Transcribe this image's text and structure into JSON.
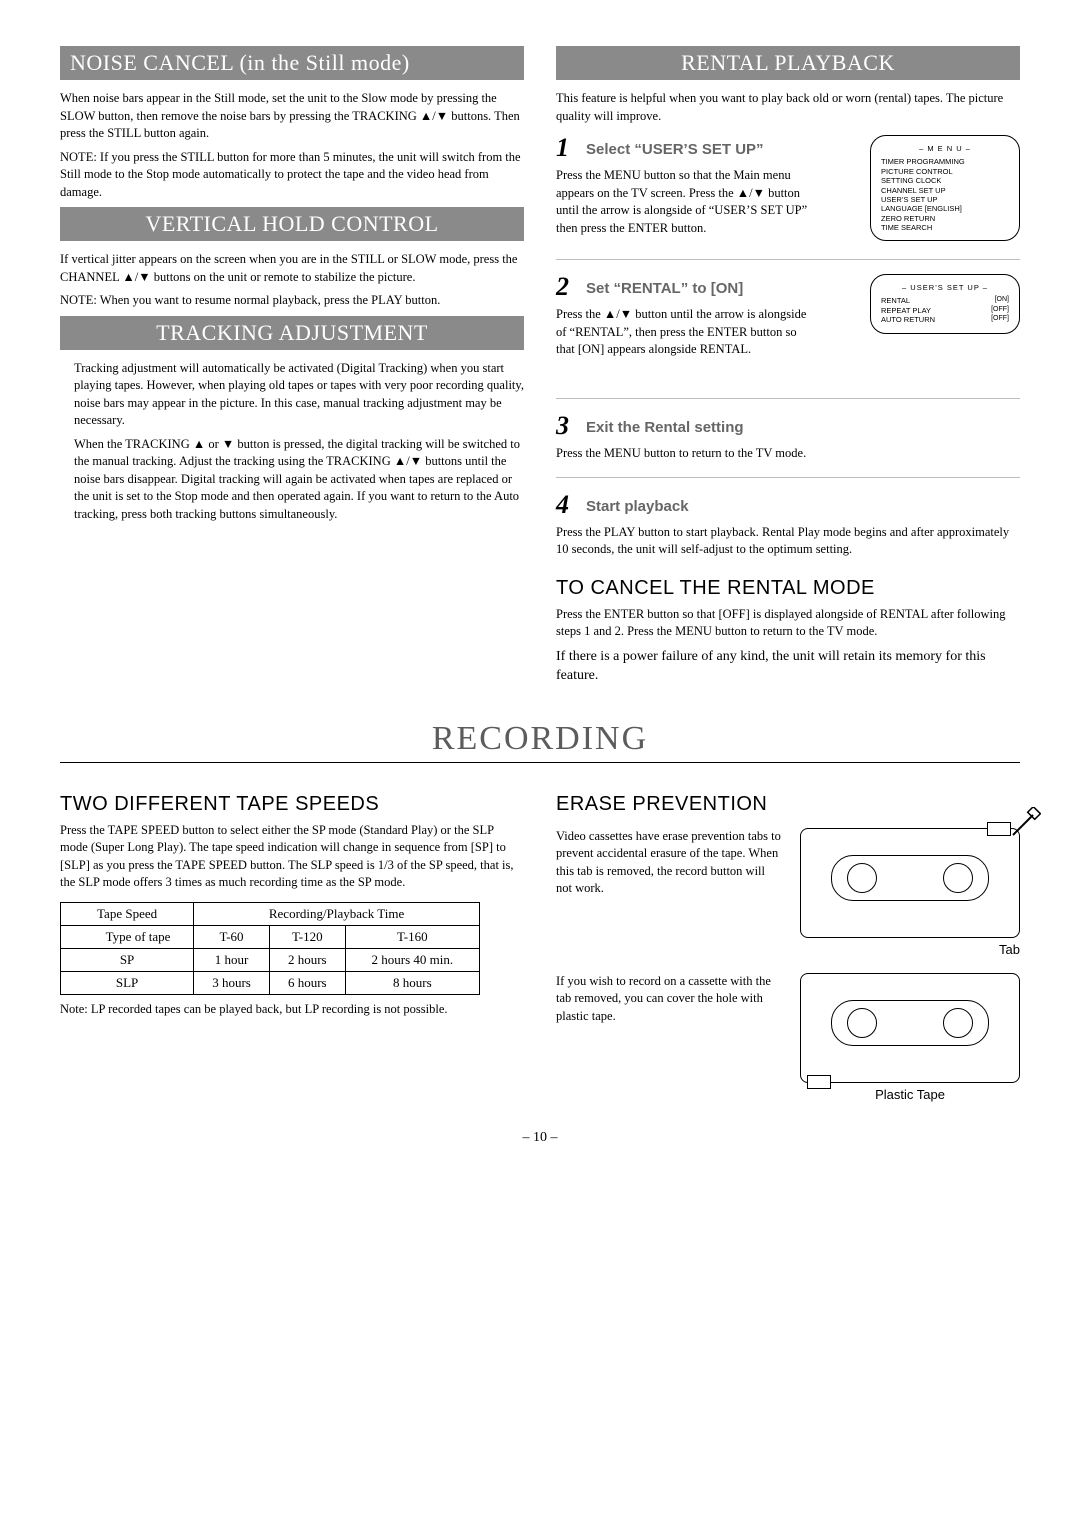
{
  "page_number": "– 10 –",
  "left": {
    "noise_cancel": {
      "title": "NOISE CANCEL  (in the Still mode)",
      "p1": "When noise bars appear in the Still mode, set the unit to the Slow mode by pressing the SLOW button, then remove the noise bars by pressing the TRACKING ▲/▼ buttons. Then press the STILL button again.",
      "note": "NOTE: If you press the STILL button for more than 5 minutes, the unit will switch from the Still mode to the Stop mode automatically to protect the tape and the video head from damage."
    },
    "vertical_hold": {
      "title": "VERTICAL HOLD CONTROL",
      "p1": "If vertical jitter appears on the screen when you are in the STILL or SLOW mode, press the CHANNEL ▲/▼ buttons on the unit or remote to stabilize the picture.",
      "note": "NOTE: When you want to resume normal playback, press the PLAY button."
    },
    "tracking": {
      "title": "TRACKING ADJUSTMENT",
      "p1": "Tracking adjustment will automatically be activated (Digital Tracking) when you start playing tapes. However, when playing old tapes or tapes with very poor recording quality, noise bars may appear in the picture. In this case, manual tracking adjustment may be necessary.",
      "p2": "When the TRACKING ▲ or ▼ button is pressed, the digital tracking will be switched to the manual tracking. Adjust the tracking using the TRACKING ▲/▼ buttons until the noise bars disappear. Digital tracking will again be activated when tapes are replaced or the unit is set to the Stop mode and then operated again. If you want to return to the Auto tracking, press both tracking buttons simultaneously."
    }
  },
  "right": {
    "rental": {
      "title": "RENTAL PLAYBACK",
      "intro": "This feature is helpful when you want to play back old or worn (rental) tapes. The picture quality will improve.",
      "step1_label": "Select “USER’S SET UP”",
      "step1_body": "Press the MENU button so that the Main menu appears on the TV screen.\nPress the ▲/▼ button until the arrow is alongside of “USER’S SET UP” then press the ENTER button.",
      "step2_label": "Set “RENTAL” to [ON]",
      "step2_body": "Press the ▲/▼ button until the arrow is alongside of “RENTAL”, then press the ENTER button so that [ON] appears alongside RENTAL.",
      "step3_label": "Exit the Rental setting",
      "step3_body": "Press the MENU button to return to the TV mode.",
      "step4_label": "Start playback",
      "step4_body": "Press the PLAY button to start playback. Rental Play mode begins and after approximately 10 seconds, the unit will self-adjust to the optimum setting.",
      "cancel_title": "TO CANCEL THE RENTAL MODE",
      "cancel_body": "Press the ENTER button so that [OFF] is displayed alongside of RENTAL after following steps 1 and 2.\nPress the MENU button to return to the TV mode.",
      "footer": "If there is a power failure of any kind, the unit will retain its memory for this feature.",
      "osd1_title": "– M E N U –",
      "osd1_items": [
        "TIMER PROGRAMMING",
        "PICTURE CONTROL",
        "SETTING CLOCK",
        "CHANNEL SET UP",
        "USER’S SET UP",
        "LANGUAGE  [ENGLISH]",
        "ZERO RETURN",
        "TIME SEARCH"
      ],
      "osd2_title": "– USER’S SET UP –",
      "osd2_rows": [
        {
          "k": "RENTAL",
          "v": "[ON]"
        },
        {
          "k": "REPEAT PLAY",
          "v": "[OFF]"
        },
        {
          "k": "AUTO RETURN",
          "v": "[OFF]"
        }
      ]
    }
  },
  "recording": {
    "title": "RECORDING",
    "speeds": {
      "title": "TWO DIFFERENT TAPE SPEEDS",
      "p1": "Press the TAPE SPEED button to select either the SP mode (Standard Play) or the SLP mode (Super Long Play). The tape speed indication will change in sequence from [SP] to [SLP] as you press the TAPE SPEED button. The SLP speed is 1/3 of the SP speed, that is, the SLP mode offers 3 times as much recording time as the SP mode.",
      "table": {
        "head": [
          "Tape Speed",
          "Recording/Playback Time"
        ],
        "typeHead": "Type of tape",
        "types": [
          "T-60",
          "T-120",
          "T-160"
        ],
        "rows": [
          {
            "speed": "SP",
            "cells": [
              "1 hour",
              "2 hours",
              "2 hours 40 min."
            ]
          },
          {
            "speed": "SLP",
            "cells": [
              "3 hours",
              "6 hours",
              "8 hours"
            ]
          }
        ]
      },
      "note": "Note: LP recorded tapes can be played back, but LP recording is not possible."
    },
    "erase": {
      "title": "ERASE PREVENTION",
      "p1": "Video cassettes have erase prevention tabs to prevent accidental erasure of the tape. When this tab is removed, the record button will not work.",
      "p2": "If you wish to record on a cassette with the tab removed, you can cover the hole with plastic tape.",
      "tab_label": "Tab",
      "tape_label": "Plastic Tape"
    }
  }
}
